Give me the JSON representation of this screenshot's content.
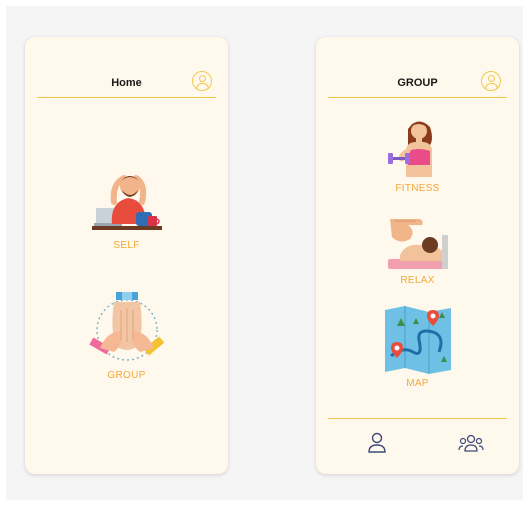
{
  "home_screen": {
    "title": "Home",
    "items": [
      {
        "label": "SELF"
      },
      {
        "label": "GROUP"
      }
    ]
  },
  "group_screen": {
    "title": "GROUP",
    "items": [
      {
        "label": "FITNESS"
      },
      {
        "label": "RELAX"
      },
      {
        "label": "MAP"
      }
    ],
    "bottom_nav": [
      "person-icon",
      "group-icon"
    ]
  },
  "colors": {
    "accent": "#f2c94c",
    "label": "#f2a93b",
    "card": "#fff8ec",
    "nav_icon": "#3b4a7a"
  }
}
